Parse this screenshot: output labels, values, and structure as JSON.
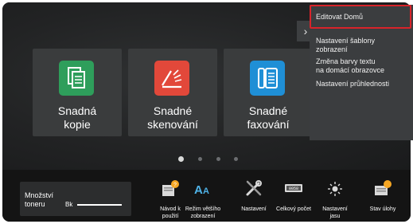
{
  "tiles": [
    {
      "label": "Snadná\nkopie",
      "icon": "copy-icon",
      "color": "#2e9e5b"
    },
    {
      "label": "Snadné\nskenování",
      "icon": "scan-icon",
      "color": "#e2483a"
    },
    {
      "label": "Snadné\nfaxování",
      "icon": "fax-icon",
      "color": "#1f8fd6"
    }
  ],
  "pagination": {
    "pages": 4,
    "current": 1
  },
  "menu": {
    "items": [
      "Editovat Domů",
      "Nastavení šablony\nzobrazení",
      "Změna barvy textu\nna domácí obrazovce",
      "Nastavení průhlednosti"
    ],
    "highlight_color": "#d8232a"
  },
  "toner": {
    "label": "Množství\ntoneru",
    "channel": "Bk"
  },
  "bottom_buttons": [
    {
      "label": "Návod k\npoužití",
      "icon": "manual-icon"
    },
    {
      "label": "Režim většího\nzobrazení",
      "icon": "large-text-icon"
    },
    {
      "label": "Nastavení",
      "icon": "settings-icon"
    },
    {
      "label": "Celkový počet",
      "icon": "counter-icon"
    },
    {
      "label": "Nastavení\njasu",
      "icon": "brightness-icon"
    },
    {
      "label": "Stav úlohy",
      "icon": "job-status-icon"
    }
  ]
}
